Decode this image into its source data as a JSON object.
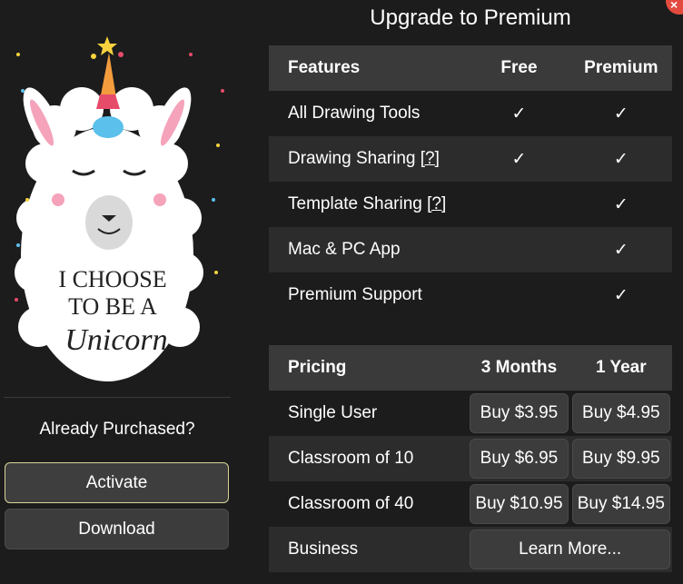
{
  "title": "Upgrade to Premium",
  "left": {
    "poster_lines": [
      "I CHOOSE",
      "TO BE A",
      "Unicorn"
    ],
    "already_purchased": "Already Purchased?",
    "activate_label": "Activate",
    "download_label": "Download"
  },
  "features": {
    "headers": [
      "Features",
      "Free",
      "Premium"
    ],
    "rows": [
      {
        "name": "All Drawing Tools",
        "help": "",
        "free": true,
        "premium": true
      },
      {
        "name": "Drawing Sharing",
        "help": "[?]",
        "free": true,
        "premium": true
      },
      {
        "name": "Template Sharing",
        "help": "[?]",
        "free": false,
        "premium": true
      },
      {
        "name": "Mac & PC App",
        "help": "",
        "free": false,
        "premium": true
      },
      {
        "name": "Premium Support",
        "help": "",
        "free": false,
        "premium": true
      }
    ]
  },
  "pricing": {
    "headers": [
      "Pricing",
      "3 Months",
      "1 Year"
    ],
    "rows": [
      {
        "name": "Single User",
        "q": "Buy $3.95",
        "y": "Buy $4.95"
      },
      {
        "name": "Classroom of 10",
        "q": "Buy $6.95",
        "y": "Buy $9.95"
      },
      {
        "name": "Classroom of 40",
        "q": "Buy $10.95",
        "y": "Buy $14.95"
      }
    ],
    "business": {
      "name": "Business",
      "action": "Learn More..."
    }
  },
  "colors": {
    "background": "#1c1c1c",
    "header_row": "#3a3a3a",
    "close_button": "#e34b3f",
    "activate_border": "#d9d59a"
  }
}
